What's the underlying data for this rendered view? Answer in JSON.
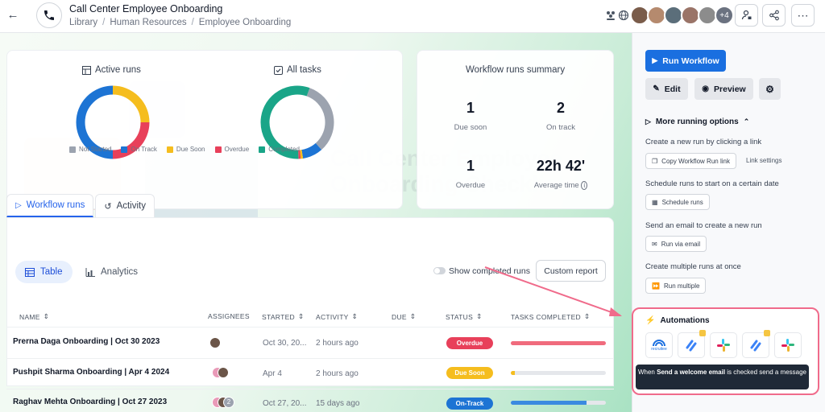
{
  "header": {
    "title": "Call Center Employee Onboarding",
    "breadcrumb": [
      "Library",
      "Human Resources",
      "Employee Onboarding"
    ],
    "avatars_more": "+4"
  },
  "cards": {
    "active_runs": "Active runs",
    "all_tasks": "All tasks",
    "legend": [
      "Not Started",
      "On Track",
      "Due Soon",
      "Overdue",
      "Completed"
    ],
    "summary_title": "Workflow runs summary",
    "stats": [
      {
        "value": "1",
        "label": "Due soon"
      },
      {
        "value": "2",
        "label": "On track"
      },
      {
        "value": "1",
        "label": "Overdue"
      },
      {
        "value": "22h 42'",
        "label": "Average time"
      }
    ]
  },
  "colors": {
    "not_started": "#9ca3af",
    "on_track": "#1d74d4",
    "due_soon": "#f5bd1e",
    "overdue": "#e8405a",
    "completed": "#1aa588",
    "primary": "#1a6fe0"
  },
  "chart_data": [
    {
      "type": "pie",
      "title": "Active runs",
      "labels": [
        "On Track",
        "Due Soon",
        "Overdue"
      ],
      "values": [
        2,
        1,
        1
      ]
    },
    {
      "type": "pie",
      "title": "All tasks",
      "labels": [
        "Not Started",
        "On Track",
        "Due Soon",
        "Overdue",
        "Completed"
      ],
      "values": [
        33,
        9,
        1,
        1,
        56
      ]
    }
  ],
  "tabs": [
    "Workflow runs",
    "Activity"
  ],
  "views": [
    "Table",
    "Analytics"
  ],
  "controls": {
    "show_completed": "Show completed runs",
    "custom_report": "Custom report"
  },
  "table": {
    "headers": [
      "NAME",
      "ASSIGNEES",
      "STARTED",
      "ACTIVITY",
      "DUE",
      "STATUS",
      "TASKS COMPLETED"
    ],
    "rows": [
      {
        "name": "Prerna Daga Onboarding | Oct 30 2023",
        "started": "Oct 30, 20...",
        "activity": "2 hours ago",
        "status": "Overdue",
        "assignee_extra": "",
        "progress": 1.0
      },
      {
        "name": "Pushpit Sharma Onboarding | Apr 4 2024",
        "started": "Apr 4",
        "activity": "2 hours ago",
        "status": "Due Soon",
        "assignee_extra": "",
        "progress": 0.04
      },
      {
        "name": "Raghav Mehta Onboarding | Oct 27 2023",
        "started": "Oct 27, 20...",
        "activity": "15 days ago",
        "status": "On-Track",
        "assignee_extra": "2",
        "progress": 0.8
      }
    ]
  },
  "sidebar": {
    "run_workflow": "Run Workflow",
    "edit": "Edit",
    "preview": "Preview",
    "more_options": "More running options",
    "link_text": "Create a new run by clicking a link",
    "copy_link": "Copy Workflow Run link",
    "link_settings": "Link settings",
    "schedule_text": "Schedule runs to start on a certain date",
    "schedule_btn": "Schedule runs",
    "email_text": "Send an email to create a new run",
    "email_btn": "Run via email",
    "multiple_text": "Create multiple runs at once",
    "multiple_btn": "Run multiple",
    "automations": "Automations",
    "recruitee": "recruitee",
    "tooltip_pre": "When ",
    "tooltip_bold": "Send a welcome email",
    "tooltip_post": " is checked send a message"
  }
}
